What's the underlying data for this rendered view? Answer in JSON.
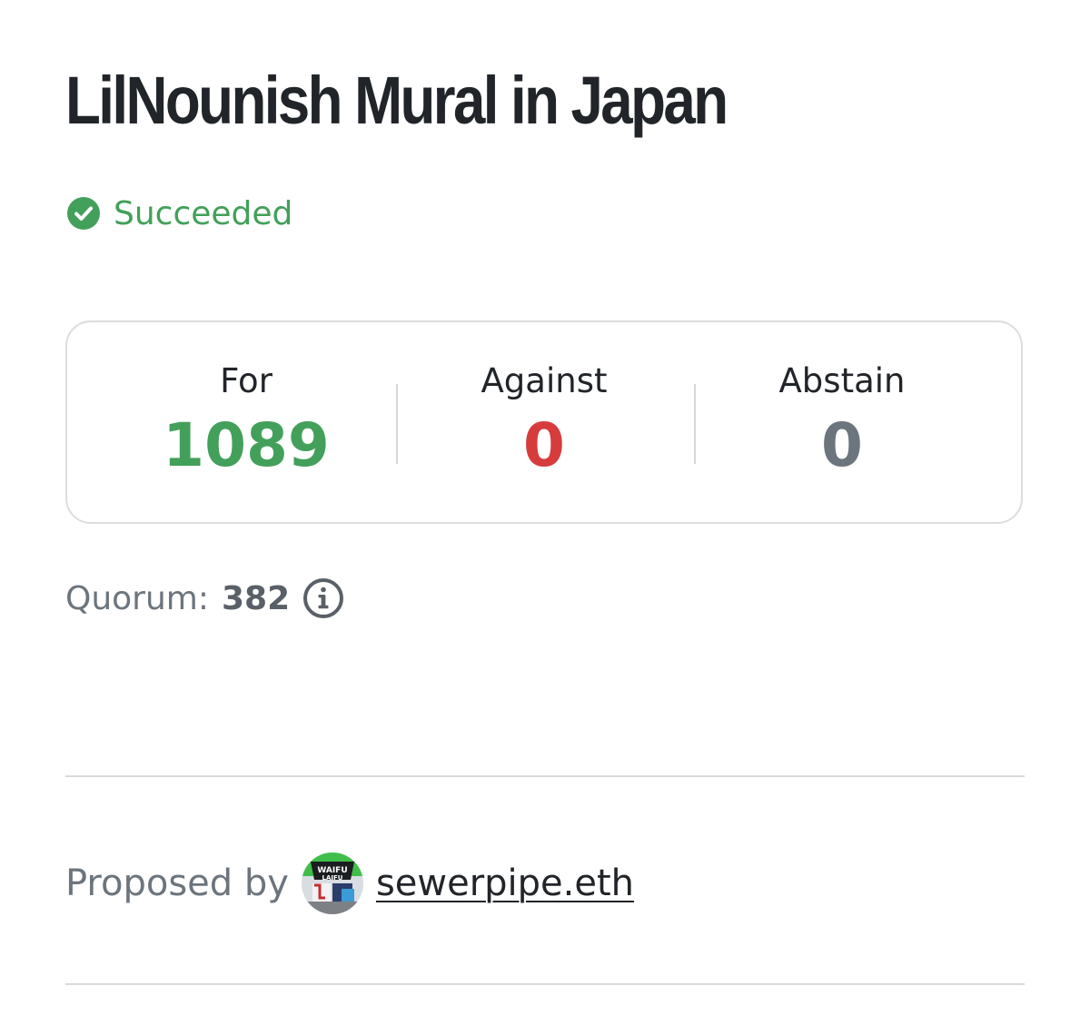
{
  "proposal": {
    "title": "LilNounish Mural in Japan",
    "status": {
      "label": "Succeeded",
      "icon": "check-circle-icon",
      "color": "#43a05a"
    }
  },
  "votes": {
    "for": {
      "label": "For",
      "value": "1089",
      "color": "#43a05a"
    },
    "against": {
      "label": "Against",
      "value": "0",
      "color": "#d63c3c"
    },
    "abstain": {
      "label": "Abstain",
      "value": "0",
      "color": "#6c757d"
    }
  },
  "quorum": {
    "label": "Quorum:",
    "value": "382",
    "icon": "info-icon"
  },
  "proposer": {
    "label": "Proposed by",
    "name": "sewerpipe.eth",
    "avatar_icon": "avatar-image"
  }
}
